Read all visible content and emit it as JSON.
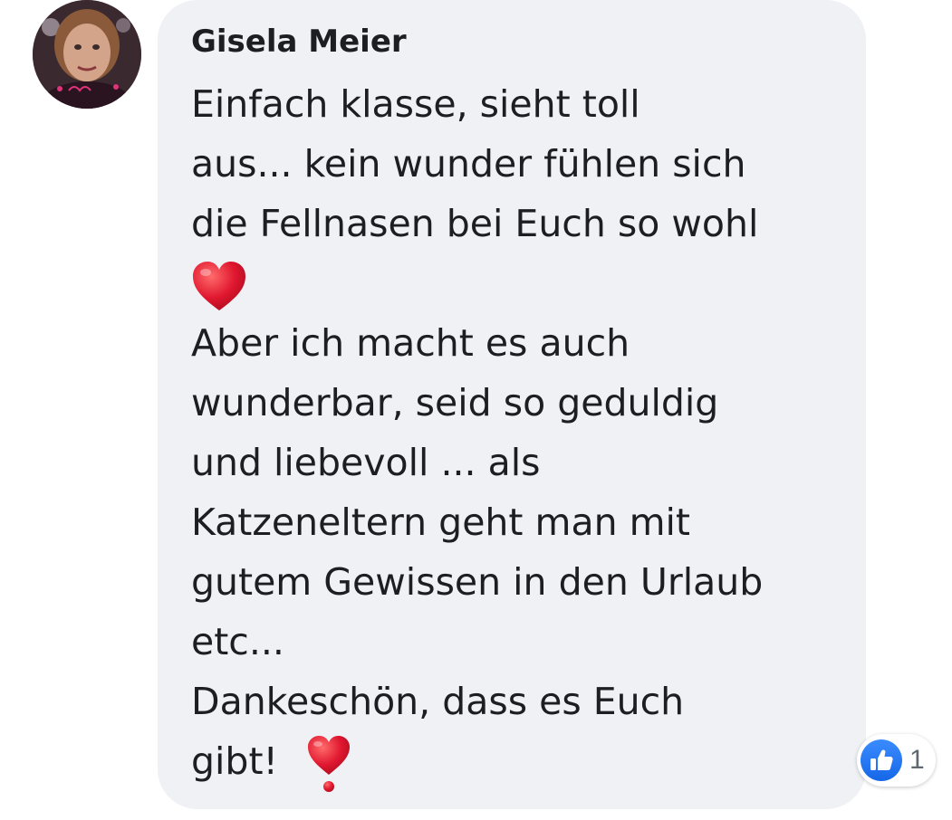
{
  "comment": {
    "author": "Gisela Meier",
    "lines_part1": [
      "Einfach klasse, sieht toll",
      "aus... kein wunder fühlen sich",
      "die Fellnasen bei Euch so wohl"
    ],
    "emoji_1": "red-heart",
    "lines_part2": [
      "Aber ich macht es auch",
      "wunderbar, seid so geduldig",
      "und liebevoll ... als",
      "Katzeneltern geht man mit",
      "gutem Gewissen in den Urlaub",
      "etc...",
      "Dankeschön, dass es Euch"
    ],
    "last_line": "gibt!",
    "emoji_2": "heavy-heart-exclamation",
    "reactions": {
      "icon": "like-icon",
      "count": "1"
    }
  },
  "colors": {
    "bubble_background": "#f0f1f5",
    "text": "#1c1e21",
    "like_blue": "#1877f2",
    "heart_red": "#e0172f"
  }
}
